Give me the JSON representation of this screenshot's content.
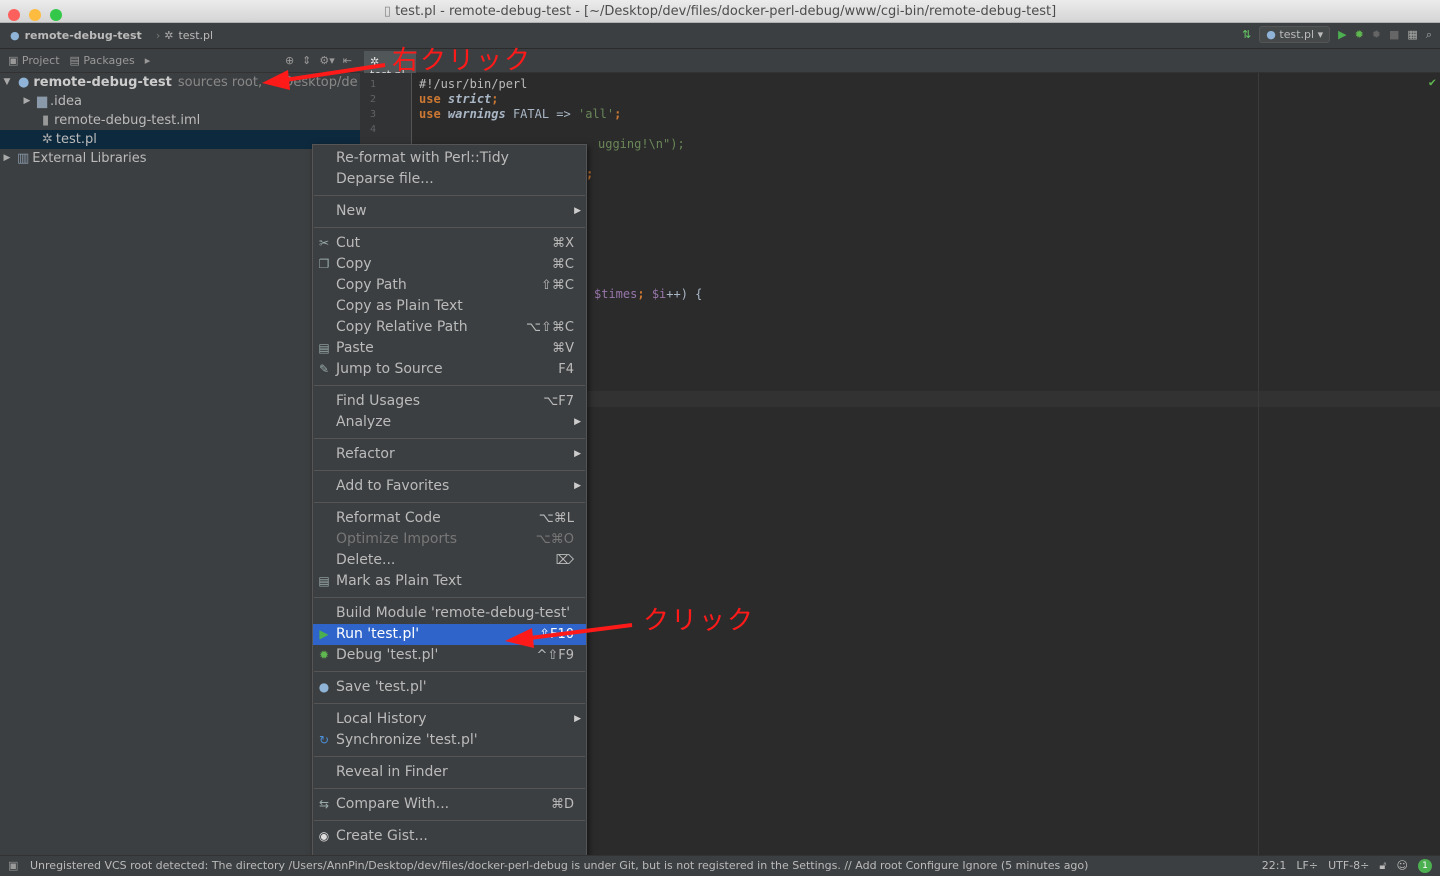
{
  "window": {
    "title": "test.pl - remote-debug-test - [~/Desktop/dev/files/docker-perl-debug/www/cgi-bin/remote-debug-test]"
  },
  "nav": {
    "crumbs": [
      "remote-debug-test",
      "test.pl"
    ],
    "run_config": "test.pl"
  },
  "tool_window": {
    "tabs": [
      "Project",
      "Packages"
    ]
  },
  "editor": {
    "tab": "test.pl",
    "line_numbers": [
      "1",
      "2",
      "3",
      "4"
    ],
    "lines": {
      "l1": "#!/usr/bin/perl",
      "l2_kw": "use",
      "l2_mod": "strict",
      "l2_end": ";",
      "l3_kw": "use",
      "l3_mod": "warnings",
      "l3_rest": " FATAL => ",
      "l3_str": "'all'",
      "l3_end": ";",
      "l5_fragment": "ugging!\\n\");",
      "l7_fragment": ";",
      "l13_var1": "$times",
      "l13_mid": "; ",
      "l13_var2": "$i",
      "l13_end": "++) {"
    }
  },
  "tree": {
    "root_name": "remote-debug-test",
    "root_suffix": "sources root,",
    "root_path": "~/Desktop/de",
    "items": [
      ".idea",
      "remote-debug-test.iml",
      "test.pl"
    ],
    "external": "External Libraries"
  },
  "context_menu": {
    "reformat_tidy": "Re-format with Perl::Tidy",
    "deparse": "Deparse file...",
    "new": "New",
    "cut": "Cut",
    "cut_sc": "⌘X",
    "copy": "Copy",
    "copy_sc": "⌘C",
    "copy_path": "Copy Path",
    "copy_path_sc": "⇧⌘C",
    "copy_plain": "Copy as Plain Text",
    "copy_rel": "Copy Relative Path",
    "copy_rel_sc": "⌥⇧⌘C",
    "paste": "Paste",
    "paste_sc": "⌘V",
    "jump": "Jump to Source",
    "jump_sc": "F4",
    "find": "Find Usages",
    "find_sc": "⌥F7",
    "analyze": "Analyze",
    "refactor": "Refactor",
    "favorites": "Add to Favorites",
    "reformat": "Reformat Code",
    "reformat_sc": "⌥⌘L",
    "optimize": "Optimize Imports",
    "optimize_sc": "⌥⌘O",
    "delete": "Delete...",
    "delete_sc": "⌦",
    "mark_plain": "Mark as Plain Text",
    "build": "Build Module 'remote-debug-test'",
    "run": "Run 'test.pl'",
    "run_sc": "⇧F10",
    "debug": "Debug 'test.pl'",
    "debug_sc": "^⇧F9",
    "save": "Save 'test.pl'",
    "history": "Local History",
    "sync": "Synchronize 'test.pl'",
    "reveal": "Reveal in Finder",
    "compare": "Compare With...",
    "compare_sc": "⌘D",
    "gist": "Create Gist..."
  },
  "annotations": {
    "right_click": "右クリック",
    "click": "クリック"
  },
  "status": {
    "message": "Unregistered VCS root detected: The directory /Users/AnnPin/Desktop/dev/files/docker-perl-debug is under Git, but is not registered in the Settings. // Add root  Configure  Ignore (5 minutes ago)",
    "position": "22:1",
    "line_sep": "LF÷",
    "encoding": "UTF-8÷",
    "notif_count": "1"
  },
  "colors": {
    "accent": "#2f65ca",
    "annotation": "#ff1a1a"
  }
}
